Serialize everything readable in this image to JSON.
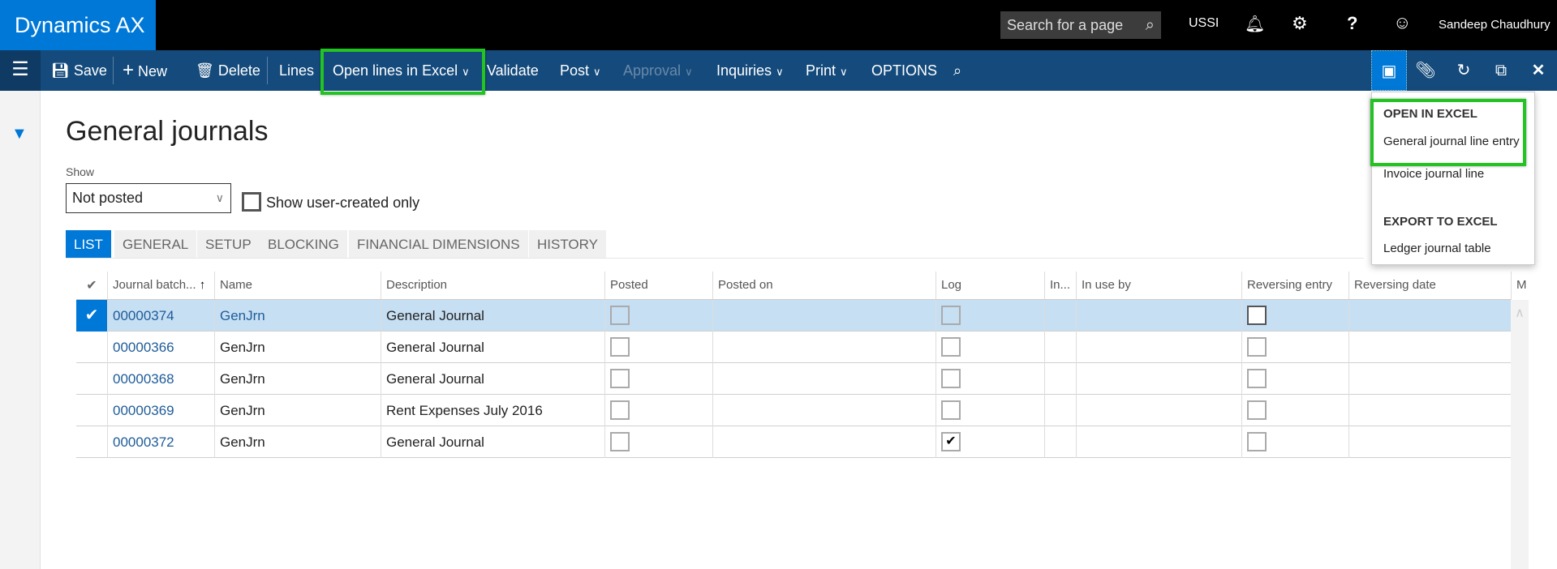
{
  "app": {
    "title": "Dynamics AX",
    "search_placeholder": "Search for a page",
    "company": "USSI",
    "user": "Sandeep Chaudhury"
  },
  "toolbar": {
    "save": "Save",
    "new": "New",
    "delete": "Delete",
    "lines": "Lines",
    "open_excel": "Open lines in Excel",
    "validate": "Validate",
    "post": "Post",
    "approval": "Approval",
    "inquiries": "Inquiries",
    "print": "Print",
    "options": "OPTIONS"
  },
  "page": {
    "title": "General journals",
    "show_label": "Show",
    "show_value": "Not posted",
    "user_created_label": "Show user-created only"
  },
  "tabs": [
    "LIST",
    "GENERAL",
    "SETUP",
    "BLOCKING",
    "FINANCIAL DIMENSIONS",
    "HISTORY"
  ],
  "columns": [
    "Journal batch...",
    "Name",
    "Description",
    "Posted",
    "Posted on",
    "Log",
    "In...",
    "In use by",
    "Reversing entry",
    "Reversing date",
    "M"
  ],
  "rows": [
    {
      "batch": "00000374",
      "name": "GenJrn",
      "description": "General Journal",
      "posted": false,
      "log": false,
      "reversing": false,
      "selected": true
    },
    {
      "batch": "00000366",
      "name": "GenJrn",
      "description": "General Journal",
      "posted": false,
      "log": false,
      "reversing": false
    },
    {
      "batch": "00000368",
      "name": "GenJrn",
      "description": "General Journal",
      "posted": false,
      "log": false,
      "reversing": false
    },
    {
      "batch": "00000369",
      "name": "GenJrn",
      "description": "Rent Expenses July 2016",
      "posted": false,
      "log": false,
      "reversing": false
    },
    {
      "batch": "00000372",
      "name": "GenJrn",
      "description": "General Journal",
      "posted": false,
      "log": true,
      "reversing": false
    }
  ],
  "excel_menu": {
    "open_header": "OPEN IN EXCEL",
    "open_items": [
      "General journal line entry",
      "Invoice journal line"
    ],
    "export_header": "EXPORT TO EXCEL",
    "export_items": [
      "Ledger journal table"
    ]
  },
  "colors": {
    "brand": "#0078d7",
    "nav": "#154b7c",
    "highlight": "#22c322"
  }
}
